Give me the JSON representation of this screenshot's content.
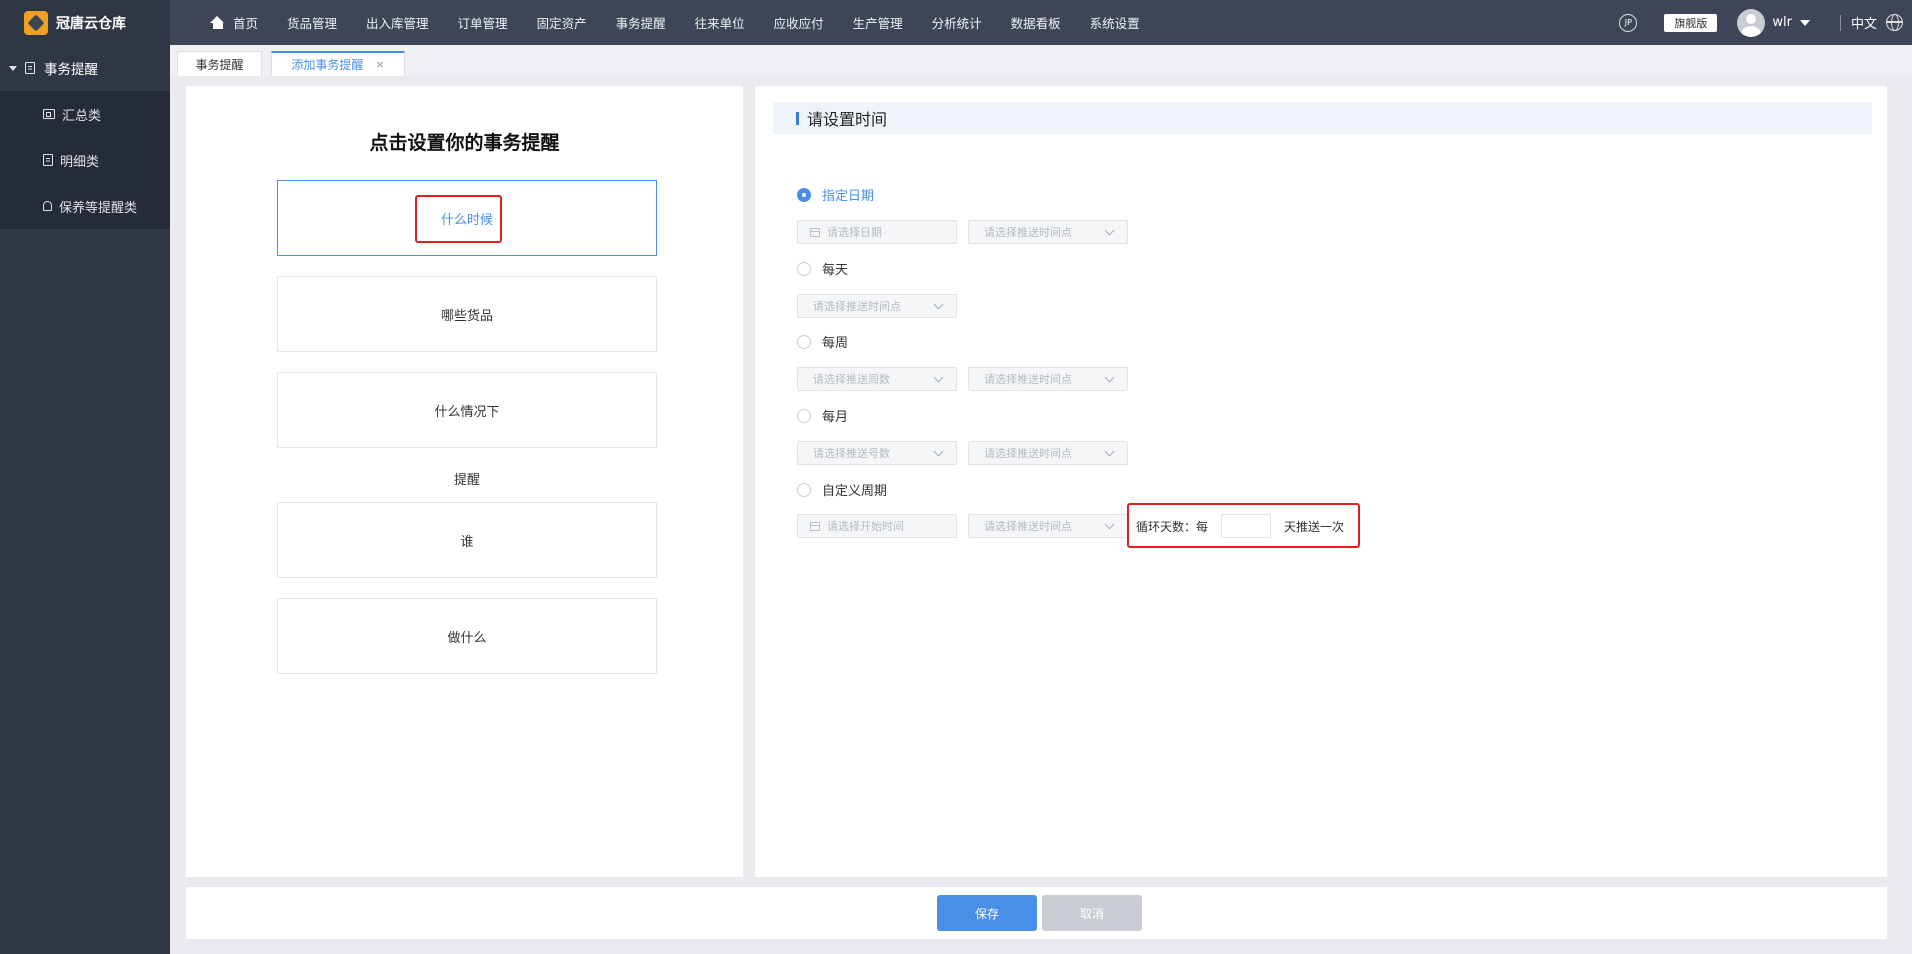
{
  "app": {
    "name": "冠唐云仓库"
  },
  "nav": [
    "首页",
    "货品管理",
    "出入库管理",
    "订单管理",
    "固定资产",
    "事务提醒",
    "往来单位",
    "应收应付",
    "生产管理",
    "分析统计",
    "数据看板",
    "系统设置"
  ],
  "topright": {
    "edition": "旗舰版",
    "username": "wlr",
    "language": "中文",
    "icon_label": "JP"
  },
  "sidebar": {
    "group": "事务提醒",
    "items": [
      {
        "label": "汇总类",
        "icon": "card-icon"
      },
      {
        "label": "明细类",
        "icon": "doc-icon"
      },
      {
        "label": "保养等提醒类",
        "icon": "bell-icon"
      }
    ]
  },
  "tabs": [
    {
      "label": "事务提醒",
      "active": false
    },
    {
      "label": "添加事务提醒",
      "active": true,
      "close": "×"
    }
  ],
  "left": {
    "title": "点击设置你的事务提醒",
    "steps": [
      "什么时候",
      "哪些货品",
      "什么情况下",
      "谁",
      "做什么"
    ],
    "between_label": "提醒"
  },
  "right": {
    "section_title": "请设置时间",
    "options": [
      {
        "label": "指定日期",
        "checked": true,
        "fields": [
          "请选择日期",
          "请选择推送时间点"
        ]
      },
      {
        "label": "每天",
        "checked": false,
        "fields": [
          "请选择推送时间点"
        ]
      },
      {
        "label": "每周",
        "checked": false,
        "fields": [
          "请选择推送周数",
          "请选择推送时间点"
        ]
      },
      {
        "label": "每月",
        "checked": false,
        "fields": [
          "请选择推送号数",
          "请选择推送时间点"
        ]
      },
      {
        "label": "自定义周期",
        "checked": false,
        "fields": [
          "请选择开始时间",
          "请选择推送时间点"
        ]
      }
    ],
    "cycle": {
      "prefix": "循环天数：每",
      "suffix": "天推送一次",
      "value": ""
    }
  },
  "footer": {
    "save": "保存",
    "cancel": "取消"
  },
  "colors": {
    "accent": "#4a8fe7",
    "highlight": "#e02020",
    "topbar": "#3d4556",
    "sidebar": "#2f3644"
  }
}
